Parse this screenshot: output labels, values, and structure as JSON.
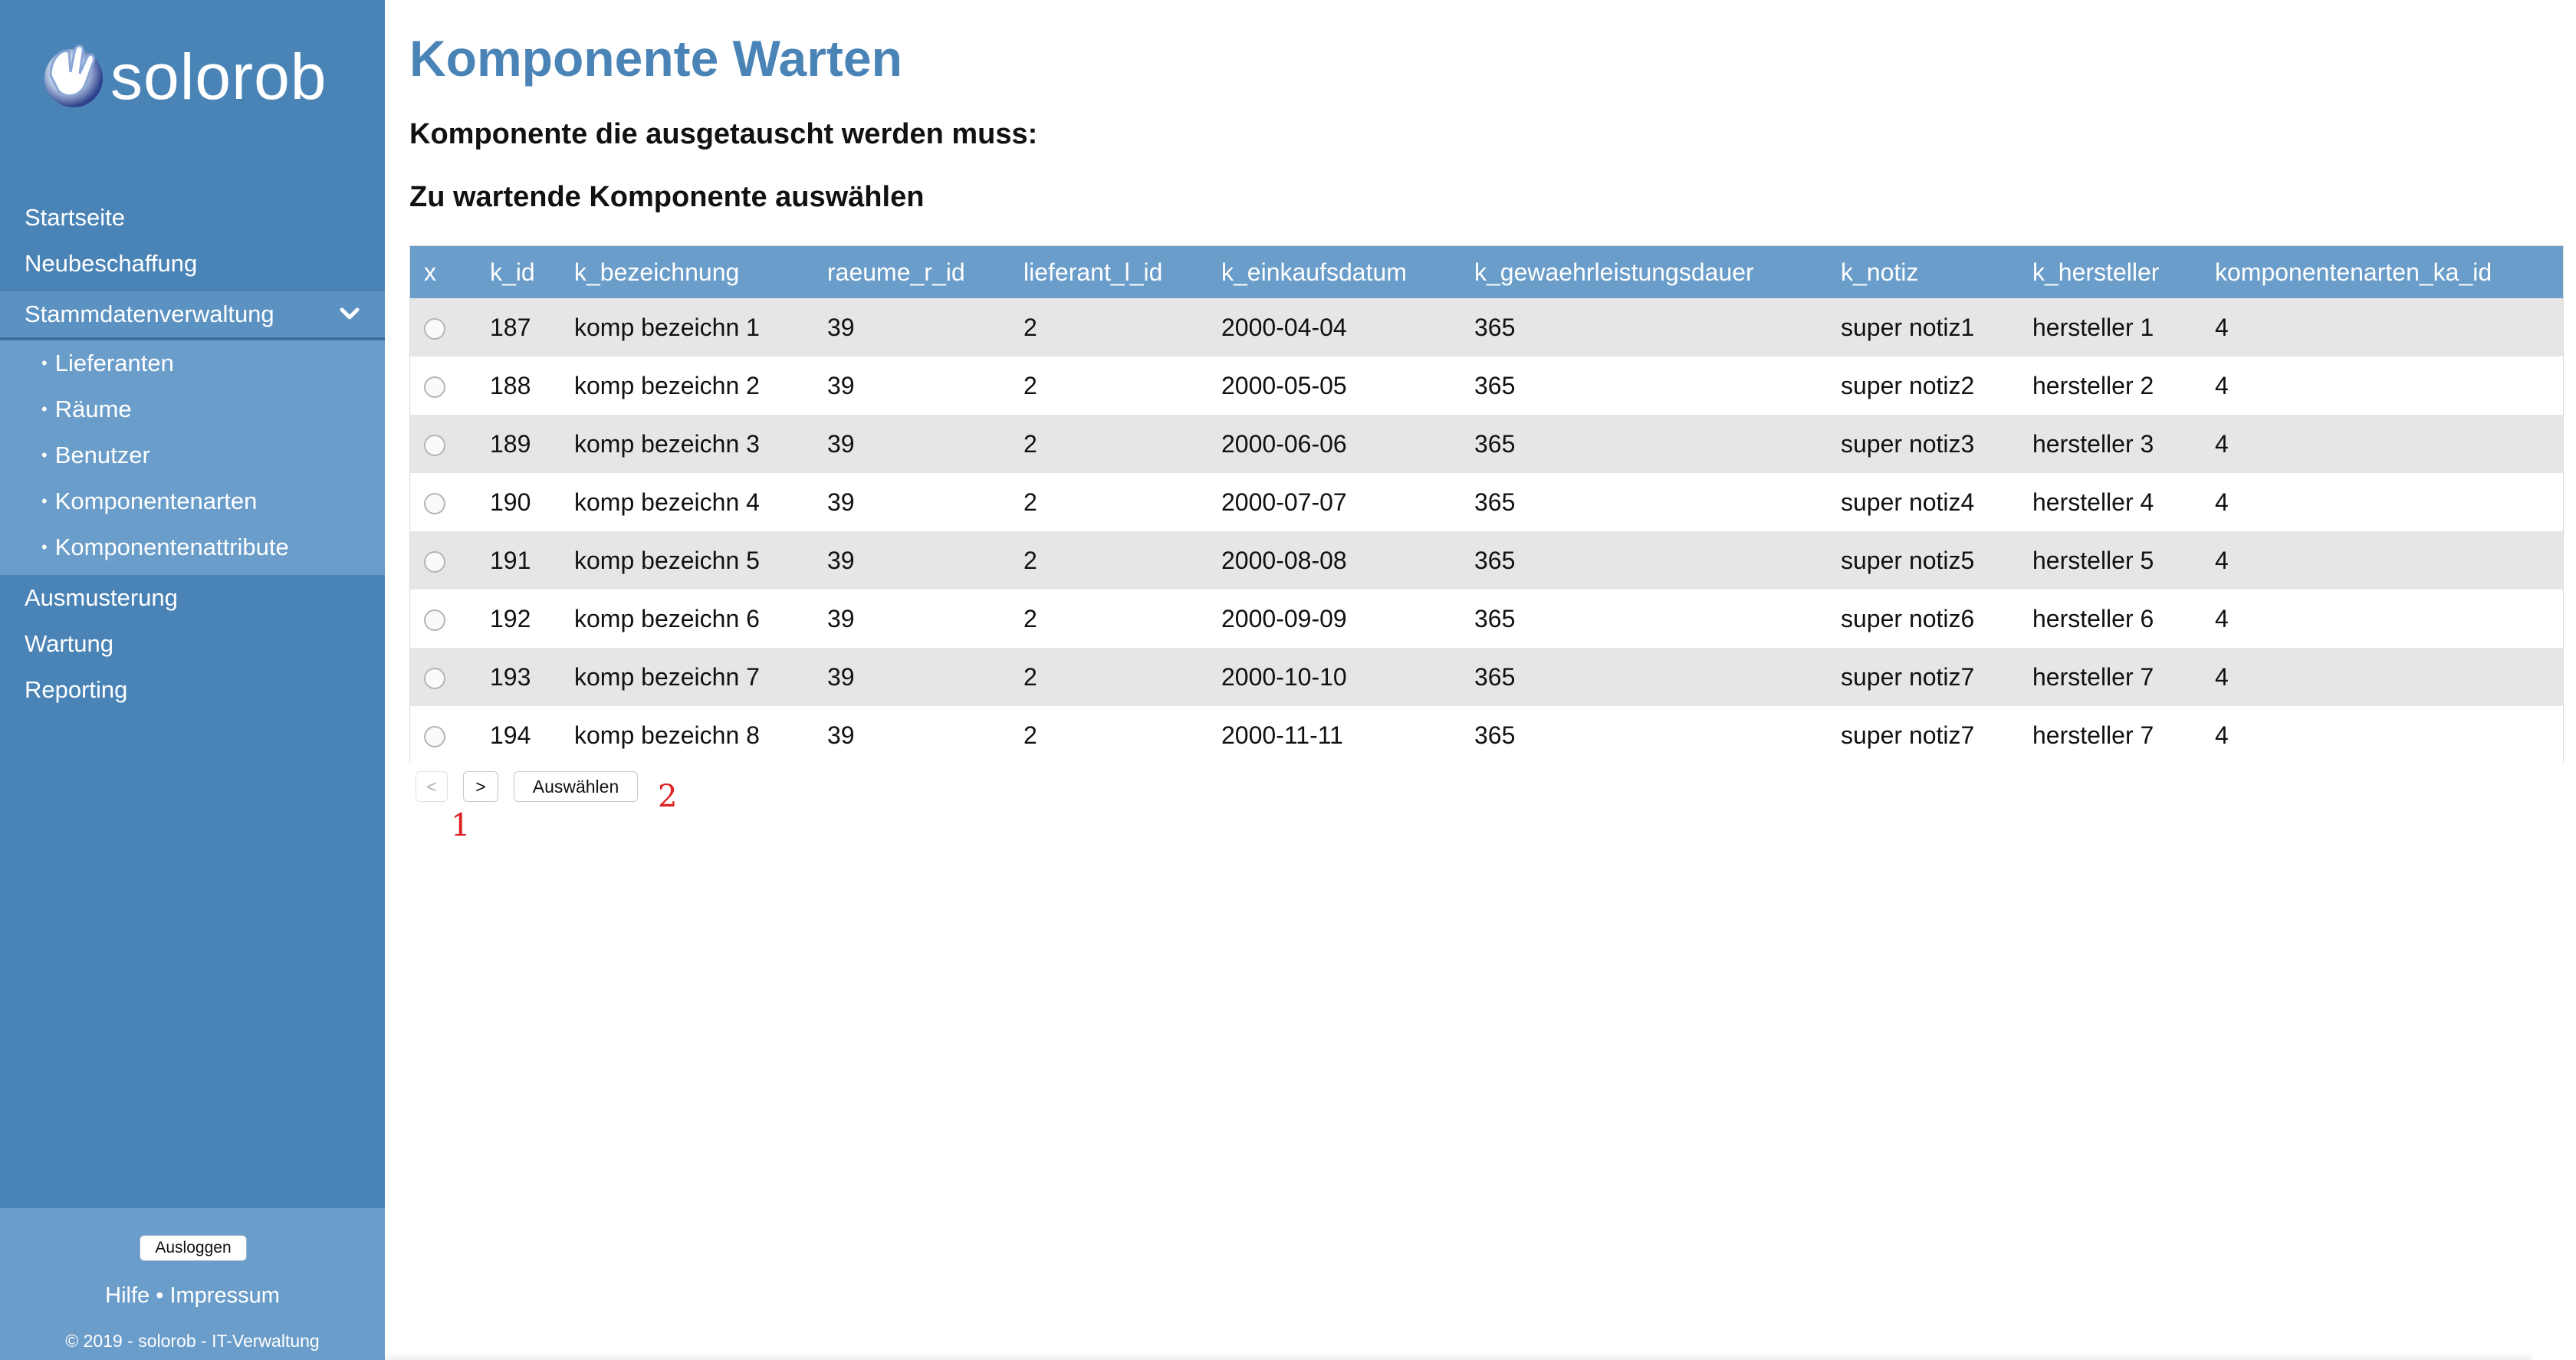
{
  "brand": {
    "name": "solorob"
  },
  "nav": {
    "items": [
      {
        "label": "Startseite"
      },
      {
        "label": "Neubeschaffung"
      },
      {
        "label": "Stammdatenverwaltung"
      },
      {
        "label": "Ausmusterung"
      },
      {
        "label": "Wartung"
      },
      {
        "label": "Reporting"
      }
    ],
    "sub_items": [
      {
        "label": "Lieferanten"
      },
      {
        "label": "Räume"
      },
      {
        "label": "Benutzer"
      },
      {
        "label": "Komponentenarten"
      },
      {
        "label": "Komponentenattribute"
      }
    ],
    "bullet": "•"
  },
  "footer": {
    "logout": "Ausloggen",
    "help": "Hilfe",
    "separator": "•",
    "imprint": "Impressum",
    "copyright": "© 2019 - solorob - IT-Verwaltung"
  },
  "page": {
    "title": "Komponente Warten",
    "subtitle_1": "Komponente die ausgetauscht werden muss:",
    "subtitle_2": "Zu wartende Komponente auswählen"
  },
  "table": {
    "columns": [
      "x",
      "k_id",
      "k_bezeichnung",
      "raeume_r_id",
      "lieferant_l_id",
      "k_einkaufsdatum",
      "k_gewaehrleistungsdauer",
      "k_notiz",
      "k_hersteller",
      "komponentenarten_ka_id"
    ],
    "rows": [
      [
        "187",
        "komp bezeichn 1",
        "39",
        "2",
        "2000-04-04",
        "365",
        "super notiz1",
        "hersteller 1",
        "4"
      ],
      [
        "188",
        "komp bezeichn 2",
        "39",
        "2",
        "2000-05-05",
        "365",
        "super notiz2",
        "hersteller 2",
        "4"
      ],
      [
        "189",
        "komp bezeichn 3",
        "39",
        "2",
        "2000-06-06",
        "365",
        "super notiz3",
        "hersteller 3",
        "4"
      ],
      [
        "190",
        "komp bezeichn 4",
        "39",
        "2",
        "2000-07-07",
        "365",
        "super notiz4",
        "hersteller 4",
        "4"
      ],
      [
        "191",
        "komp bezeichn 5",
        "39",
        "2",
        "2000-08-08",
        "365",
        "super notiz5",
        "hersteller 5",
        "4"
      ],
      [
        "192",
        "komp bezeichn 6",
        "39",
        "2",
        "2000-09-09",
        "365",
        "super notiz6",
        "hersteller 6",
        "4"
      ],
      [
        "193",
        "komp bezeichn 7",
        "39",
        "2",
        "2000-10-10",
        "365",
        "super notiz7",
        "hersteller 7",
        "4"
      ],
      [
        "194",
        "komp bezeichn 8",
        "39",
        "2",
        "2000-11-11",
        "365",
        "super notiz7",
        "hersteller 7",
        "4"
      ]
    ]
  },
  "pager": {
    "prev": "<",
    "next": ">",
    "select": "Auswählen"
  },
  "annotations": [
    "1",
    "2"
  ],
  "colors": {
    "sidebar": "#4a84b7",
    "sidebar_light": "#6a9dca",
    "title": "#4a84b7",
    "annotation": "#e02020",
    "row_alt": "#e6e6e6"
  },
  "icons": {
    "logo": "hand-globe-icon",
    "expand": "chevron-down-icon",
    "row_select": "radio-button"
  }
}
